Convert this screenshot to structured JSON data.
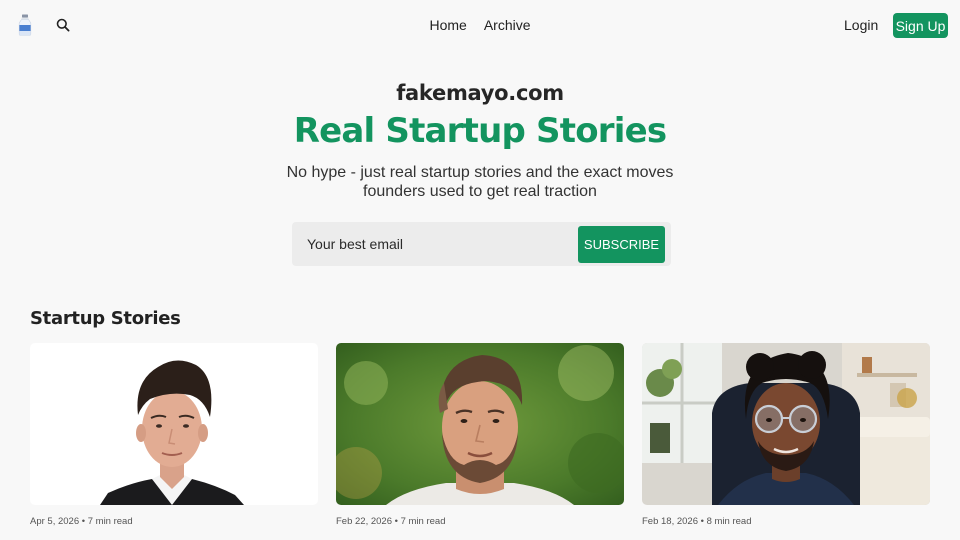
{
  "header": {
    "logo_icon": "milk-bottle-logo",
    "search_icon": "search-icon",
    "nav": [
      {
        "label": "Home"
      },
      {
        "label": "Archive"
      }
    ],
    "login_label": "Login",
    "signup_label": "Sign Up"
  },
  "hero": {
    "site_name": "fakemayo.com",
    "title": "Real Startup Stories",
    "subtitle": "No hype - just real startup stories and the exact moves founders used to get real traction",
    "email_placeholder": "Your best email",
    "subscribe_label": "SUBSCRIBE"
  },
  "stories": {
    "section_title": "Startup Stories",
    "cards": [
      {
        "date": "Apr 5, 2026",
        "read_time": "7 min read",
        "photo": "portrait-man-white-background"
      },
      {
        "date": "Feb 22, 2026",
        "read_time": "7 min read",
        "photo": "portrait-bearded-man-green-background"
      },
      {
        "date": "Feb 18, 2026",
        "read_time": "8 min read",
        "photo": "portrait-man-glasses-living-room"
      }
    ]
  },
  "colors": {
    "accent": "#13945f",
    "background": "#f8f8f8",
    "input_background": "#ececec"
  }
}
